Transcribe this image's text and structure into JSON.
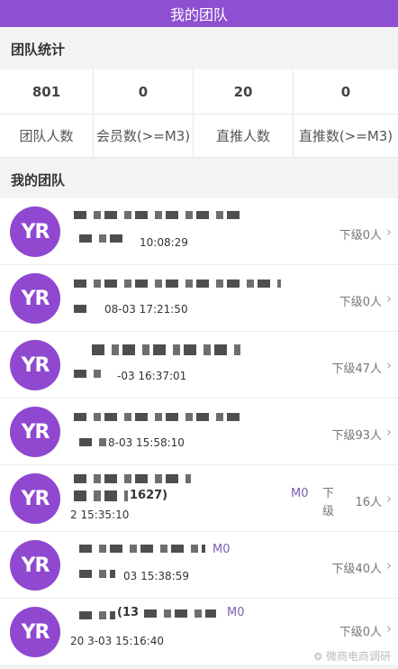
{
  "header": {
    "title": "我的团队"
  },
  "stats_section": {
    "title": "团队统计"
  },
  "stats": {
    "values": [
      "801",
      "0",
      "20",
      "0"
    ],
    "labels": [
      "团队人数",
      "会员数(>=M3)",
      "直推人数",
      "直推数(>=M3)"
    ]
  },
  "team_section": {
    "title": "我的团队"
  },
  "avatar_text": "YR",
  "members": [
    {
      "time": "10:08:29",
      "level": "",
      "count": "下级0人"
    },
    {
      "time": "08-03 17:21:50",
      "level": "",
      "count": "下级0人"
    },
    {
      "time": "-03 16:37:01",
      "level": "",
      "count": "下级47人"
    },
    {
      "time": "8-03 15:58:10",
      "level": "",
      "count": "下级93人"
    },
    {
      "name_fragment": "1627)",
      "time": "2 15:35:10",
      "level": "M0",
      "count": "16人"
    },
    {
      "time": "03 15:38:59",
      "level": "M0",
      "count": "下级40人"
    },
    {
      "name_fragment": "(13",
      "time": "20 3-03 15:16:40",
      "level": "M0",
      "count": "下级0人"
    }
  ],
  "member5_sub": "下\n级",
  "watermark": {
    "text": "微商电商调研",
    "icon": "wechat-icon"
  }
}
